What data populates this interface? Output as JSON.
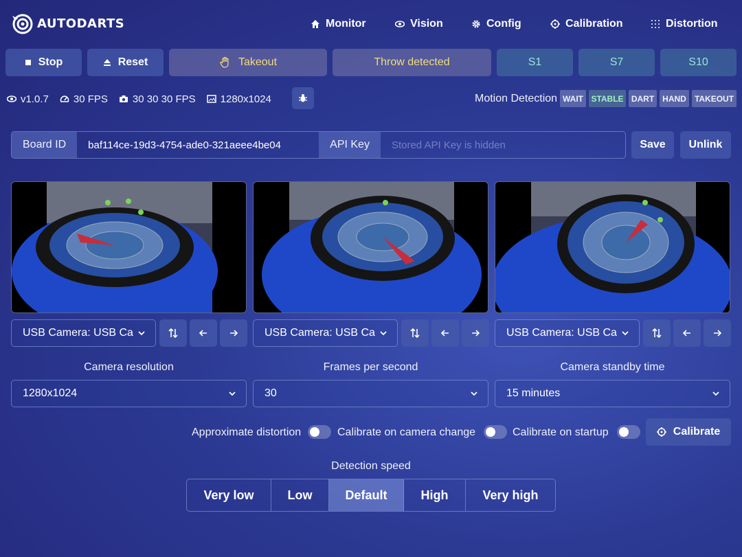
{
  "app": {
    "name": "AUTODARTS"
  },
  "nav": [
    {
      "label": "Monitor",
      "icon": "home-icon"
    },
    {
      "label": "Vision",
      "icon": "eye-icon"
    },
    {
      "label": "Config",
      "icon": "gear-icon"
    },
    {
      "label": "Calibration",
      "icon": "crosshair-icon"
    },
    {
      "label": "Distortion",
      "icon": "grid-dots-icon"
    }
  ],
  "toolbar": {
    "stop": "Stop",
    "reset": "Reset",
    "takeout": "Takeout",
    "throw": "Throw detected",
    "scores": [
      "S1",
      "S7",
      "S10"
    ]
  },
  "status": {
    "version": "v1.0.7",
    "fps": "30 FPS",
    "cam_fps": "30 30 30 FPS",
    "resolution": "1280x1024"
  },
  "motion": {
    "label": "Motion Detection",
    "states": [
      "WAIT",
      "STABLE",
      "DART",
      "HAND",
      "TAKEOUT"
    ],
    "active": "STABLE"
  },
  "board": {
    "id_label": "Board ID",
    "id_value": "baf114ce-19d3-4754-ade0-321aeee4be04",
    "api_label": "API Key",
    "api_placeholder": "Stored API Key is hidden",
    "save": "Save",
    "unlink": "Unlink"
  },
  "cameras": [
    {
      "select": "USB Camera: USB Ca"
    },
    {
      "select": "USB Camera: USB Ca"
    },
    {
      "select": "USB Camera: USB Ca"
    }
  ],
  "settings": {
    "resolution_label": "Camera resolution",
    "resolution_value": "1280x1024",
    "fps_label": "Frames per second",
    "fps_value": "30",
    "standby_label": "Camera standby time",
    "standby_value": "15 minutes"
  },
  "toggles": {
    "approx": "Approximate distortion",
    "on_change": "Calibrate on camera change",
    "on_startup": "Calibrate on startup",
    "calibrate": "Calibrate"
  },
  "speed": {
    "label": "Detection speed",
    "options": [
      "Very low",
      "Low",
      "Default",
      "High",
      "Very high"
    ],
    "selected": "Default"
  },
  "colors": {
    "accent_amber": "#f2dd77",
    "accent_teal": "#9be6d7",
    "stable_green": "#a2f0c8"
  }
}
